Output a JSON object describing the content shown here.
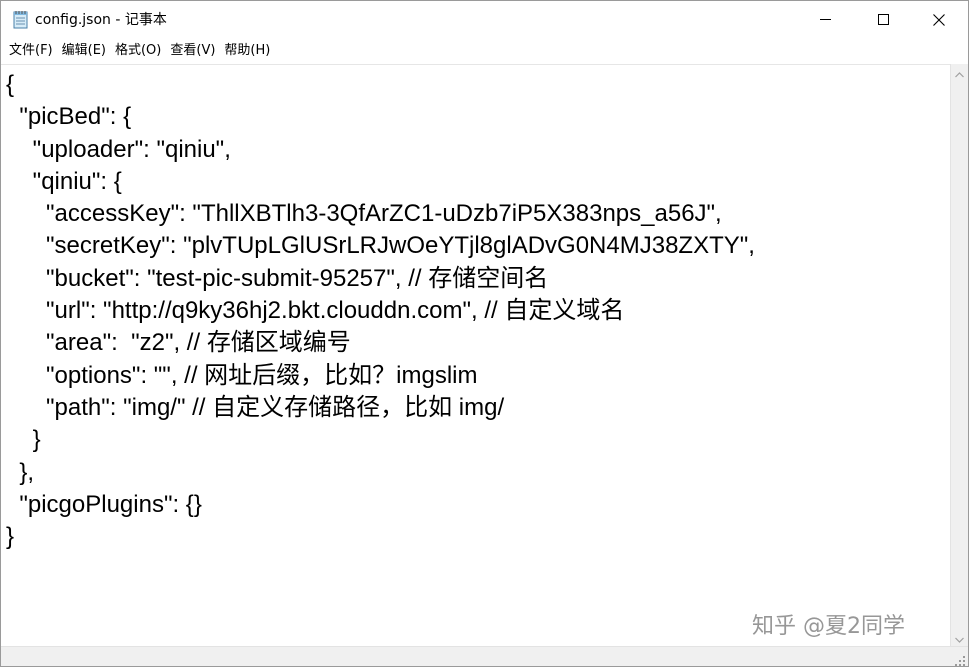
{
  "window": {
    "title": "config.json - 记事本"
  },
  "controls": {
    "minimize": "minimize",
    "maximize": "maximize",
    "close": "close"
  },
  "menu": {
    "items": [
      {
        "label": "文件(F)"
      },
      {
        "label": "编辑(E)"
      },
      {
        "label": "格式(O)"
      },
      {
        "label": "查看(V)"
      },
      {
        "label": "帮助(H)"
      }
    ]
  },
  "editor": {
    "lines": [
      "{",
      "  \"picBed\": {",
      "    \"uploader\": \"qiniu\",",
      "    \"qiniu\": {",
      "      \"accessKey\": \"ThllXBTlh3-3QfArZC1-uDzb7iP5X383nps_a56J\",",
      "      \"secretKey\": \"plvTUpLGlUSrLRJwOeYTjl8glADvG0N4MJ38ZXTY\",",
      "      \"bucket\": \"test-pic-submit-95257\", // 存储空间名",
      "      \"url\": \"http://q9ky36hj2.bkt.clouddn.com\", // 自定义域名",
      "      \"area\":  \"z2\", // 存储区域编号",
      "      \"options\": \"\", // 网址后缀，比如？imgslim",
      "      \"path\": \"img/\" // 自定义存储路径，比如 img/",
      "    }",
      "  },",
      "  \"picgoPlugins\": {}",
      "}"
    ]
  },
  "watermark": {
    "text": "知乎 @夏2同学"
  },
  "icons": {
    "app": "notepad-icon",
    "scroll_up": "chevron-up-icon",
    "scroll_down": "chevron-down-icon"
  }
}
